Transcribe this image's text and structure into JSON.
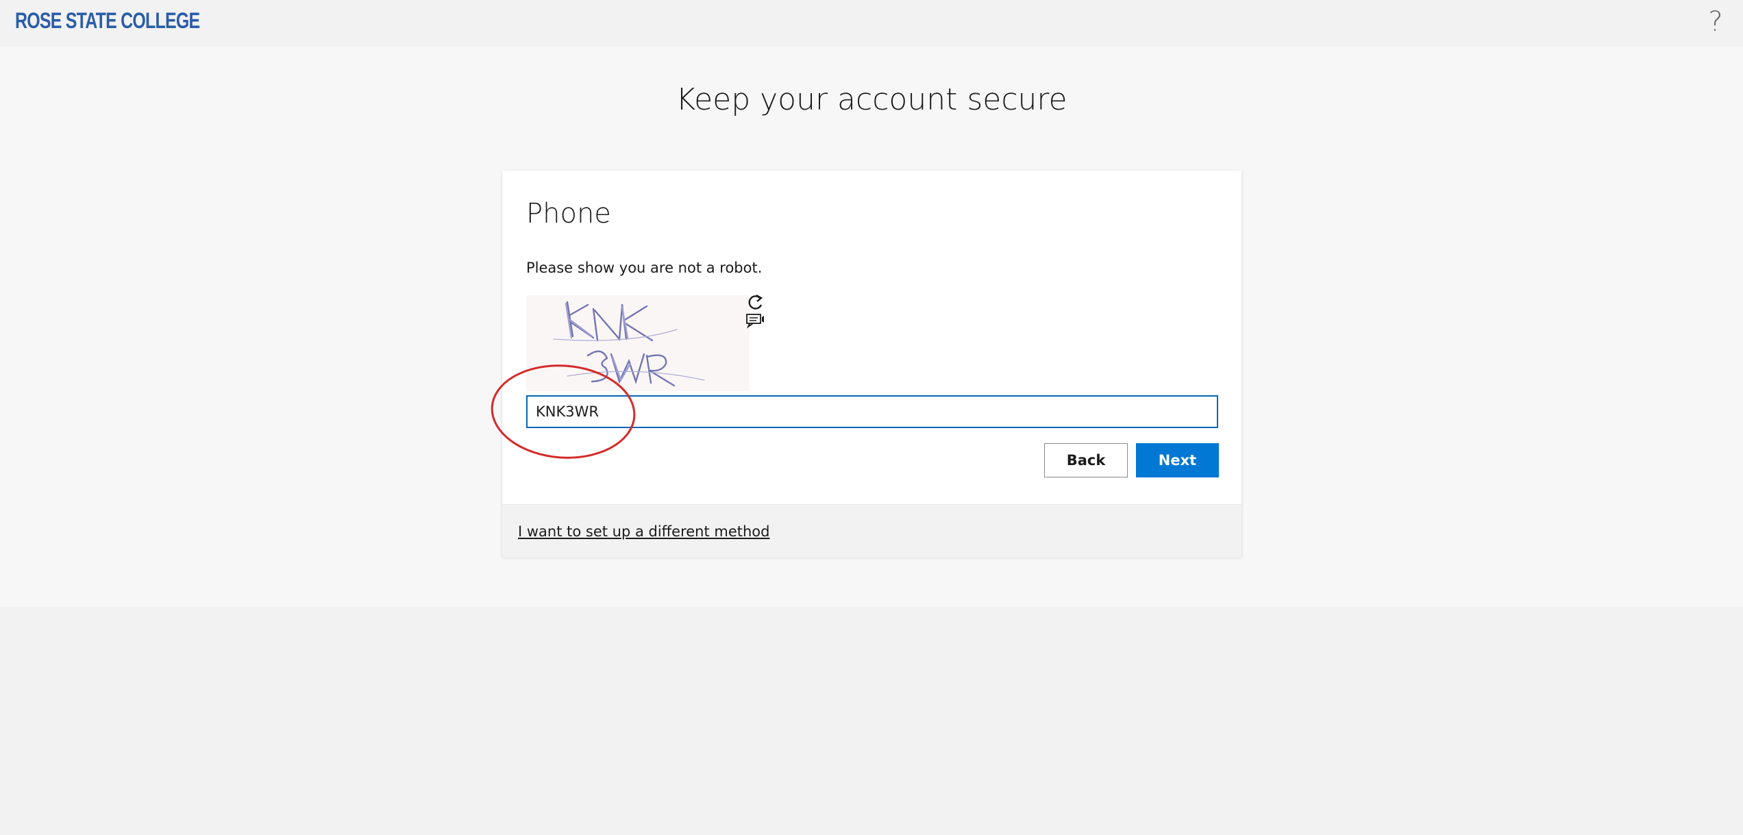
{
  "header": {
    "logo_text": "ROSE STATE COLLEGE",
    "help_label": "?"
  },
  "page": {
    "title": "Keep your account secure"
  },
  "card": {
    "title": "Phone",
    "instruction": "Please show you are not a robot.",
    "captcha": {
      "line1": "KNK",
      "line2": "3WR",
      "refresh_icon": "refresh-icon",
      "audio_icon": "audio-captcha-icon"
    },
    "input": {
      "value": "KNK3WR"
    },
    "buttons": {
      "back": "Back",
      "next": "Next"
    },
    "footer_link": "I want to set up a different method"
  },
  "colors": {
    "brand_blue": "#2a5da8",
    "primary_button": "#0078d4",
    "input_border": "#0067b8",
    "annotation_red": "#d42a2a"
  }
}
